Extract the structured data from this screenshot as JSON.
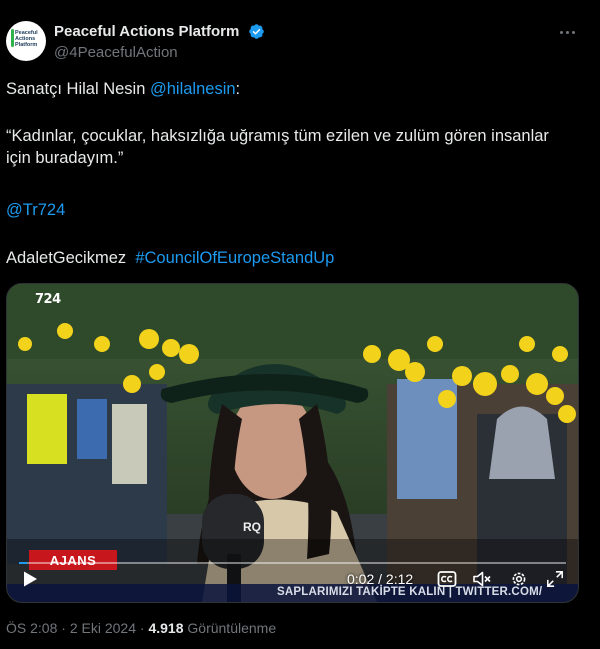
{
  "author": {
    "display_name": "Peaceful Actions Platform",
    "handle": "@4PeacefulAction",
    "avatar_logo_text": "Peaceful Actions Platform",
    "verified_icon": "verified-badge-icon"
  },
  "tweet": {
    "line1_prefix": "Sanatçı Hilal Nesin ",
    "line1_mention": "@hilalnesin",
    "line1_suffix": ":",
    "quote": "“Kadınlar, çocuklar, haksızlığa uğramış tüm ezilen ve zulüm gören insanlar için buradayım.”",
    "mention2": "@Tr724",
    "tag_plain": "AdaletGecikmez",
    "hashtag": "#CouncilOfEuropeStandUp"
  },
  "video": {
    "channel_logo": "724",
    "lower_third": "AJANS",
    "mic_text": "RQ",
    "ticker": "SAPLARIMIZI TAKİPTE KALIN | TWITTER.COM/",
    "time": "0:02 / 2:12",
    "progress": 0.015,
    "controls": [
      "play-icon",
      "captions-icon",
      "mute-icon",
      "settings-icon",
      "fullscreen-icon"
    ]
  },
  "meta": {
    "time": "ÖS 2:08",
    "sep1": " · ",
    "date": "2 Eki 2024",
    "sep2": " · ",
    "views": "4.918",
    "views_label": " Görüntülenme"
  },
  "colors": {
    "background": "#000000",
    "text": "#e7e9ea",
    "muted": "#71767b",
    "link": "#1d9bf0",
    "verified": "#1d9bf0",
    "balloon": "#f3d21b"
  }
}
